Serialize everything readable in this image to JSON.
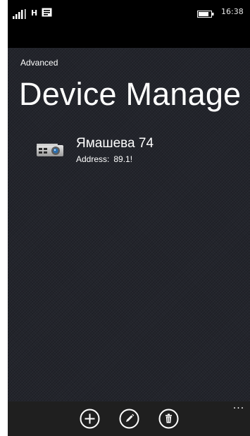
{
  "status_bar": {
    "network": "H",
    "time": "16:38"
  },
  "header": {
    "subtitle": "Advanced",
    "title": "Device Manage"
  },
  "devices": [
    {
      "name": "Ямашева 74",
      "address_label": "Address:",
      "address_value": "89.1!"
    }
  ],
  "app_bar": {
    "buttons": [
      "add-icon",
      "edit-icon",
      "delete-icon"
    ],
    "more": "..."
  },
  "colors": {
    "background": "#23252c",
    "status_bar": "#000000",
    "app_bar": "#1f1f1f",
    "text": "#ffffff"
  }
}
